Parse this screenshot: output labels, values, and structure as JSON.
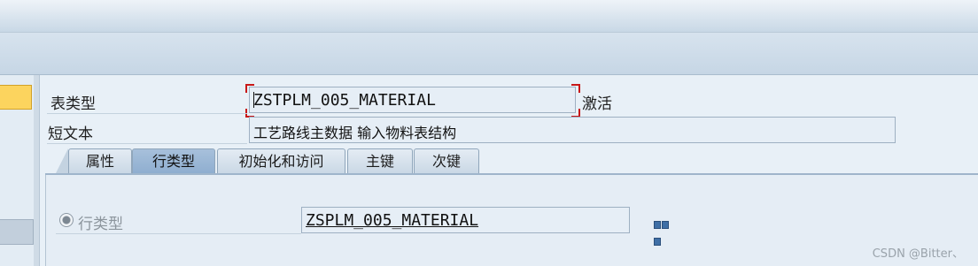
{
  "header": {
    "table_type_label": "表类型",
    "table_type_value": "ZSTPLM_005_MATERIAL",
    "status": "激活",
    "short_text_label": "短文本",
    "short_text_value": "工艺路线主数据 输入物料表结构"
  },
  "tabs": [
    {
      "label": "属性",
      "active": false
    },
    {
      "label": "行类型",
      "active": true
    },
    {
      "label": "初始化和访问",
      "active": false
    },
    {
      "label": "主键",
      "active": false
    },
    {
      "label": "次键",
      "active": false
    }
  ],
  "line_type": {
    "radio_label": "行类型",
    "value": "ZSPLM_005_MATERIAL",
    "selected": true,
    "enabled": false
  },
  "watermark": "CSDN @Bitter、",
  "icons": {
    "more_button": "multiple-selection-icon"
  },
  "colors": {
    "active_tab": "#8faed0",
    "focus_marker": "#c81818",
    "left_active_item": "#fcd45e"
  }
}
